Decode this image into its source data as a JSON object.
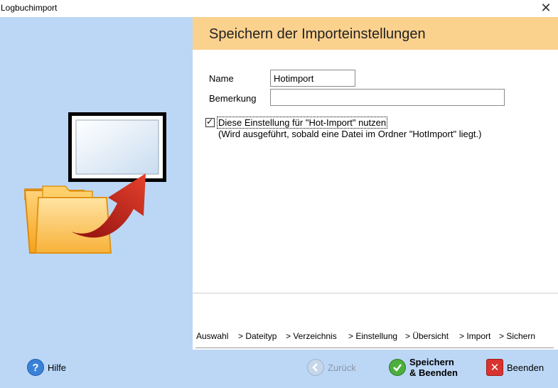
{
  "window": {
    "title": "Logbuchimport",
    "close_icon": "close-icon"
  },
  "header": {
    "title": "Speichern der Importeinstellungen"
  },
  "form": {
    "name_label": "Name",
    "name_value": "Hotimport",
    "remark_label": "Bemerkung",
    "remark_value": "",
    "hot_import_checked": true,
    "hot_import_label": "Diese Einstellung für \"Hot-Import\" nutzen",
    "hot_import_note": "(Wird ausgeführt, sobald eine Datei im Ordner \"HotImport\" liegt.)"
  },
  "steps": [
    "Auswahl",
    "> Dateityp",
    "> Verzeichnis",
    "> Einstellung",
    "> Übersicht",
    "> Import",
    "> Sichern"
  ],
  "footer": {
    "help_label": "Hilfe",
    "back_label": "Zurück",
    "save_line1": "Speichern",
    "save_line2": "& Beenden",
    "exit_label": "Beenden"
  },
  "colors": {
    "left_panel": "#bcd7f6",
    "header": "#fbd18e",
    "footer": "#bcd7f6",
    "save_icon": "#4cae3c",
    "exit_icon": "#d8332f",
    "help_icon": "#3a82d8"
  },
  "icons": {
    "illustration": "folder-export-illustration",
    "help": "help-icon",
    "back": "back-arrow-icon",
    "save": "checkmark-icon",
    "exit": "exit-icon"
  }
}
